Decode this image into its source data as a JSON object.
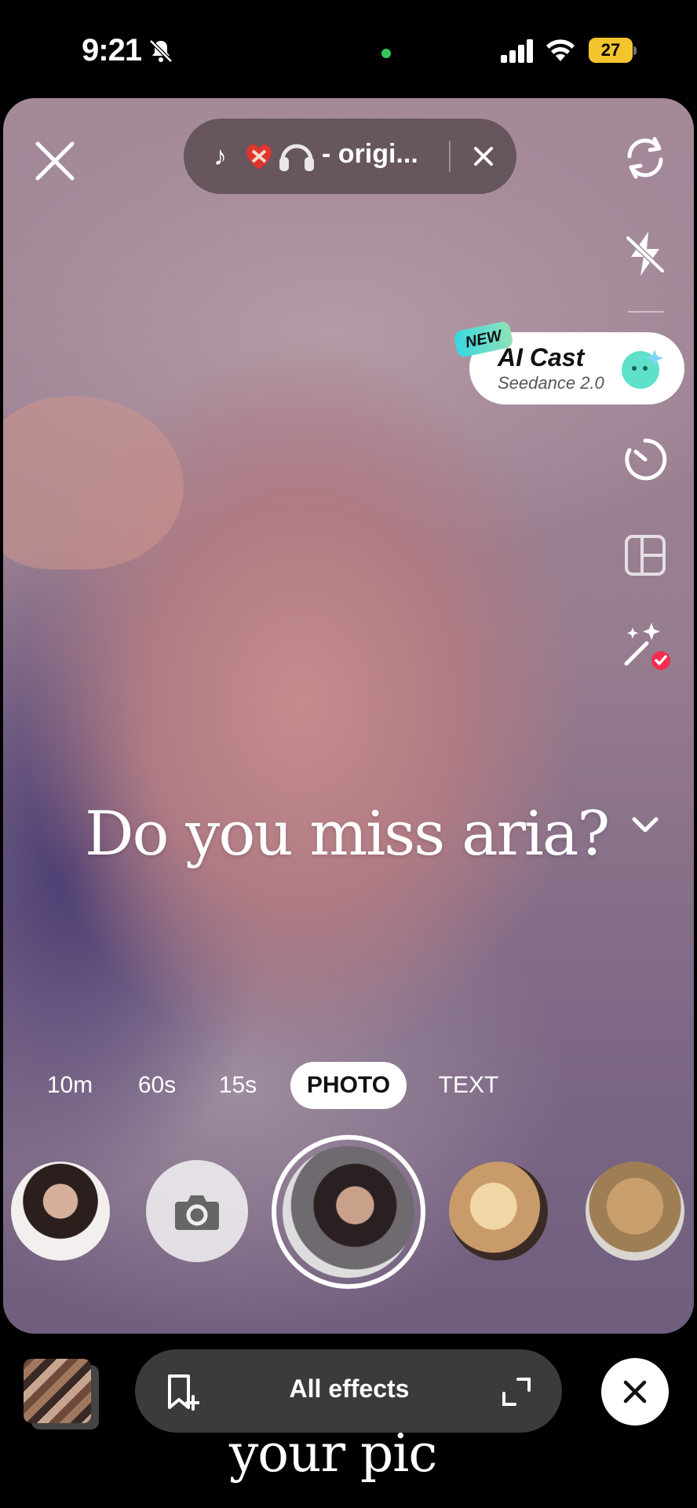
{
  "status_bar": {
    "time": "9:21",
    "battery_level": "27",
    "icons": [
      "bell-slash-icon",
      "camera-indicator-dot",
      "cellular-signal-icon",
      "wifi-icon",
      "battery-charging-icon"
    ],
    "camera_indicator_color": "#34c759",
    "battery_color": "#f3c52d"
  },
  "top_bar": {
    "close_icon": "close-icon",
    "sound": {
      "note_glyph": "♪",
      "emoji_glyphs": [
        "❤️‍🩹",
        "🎧"
      ],
      "title": "- origi...",
      "remove_icon": "close-icon"
    }
  },
  "side_tools": {
    "items": [
      "flip-camera-icon",
      "flash-off-icon",
      "timer-icon",
      "layout-icon",
      "enhance-icon"
    ],
    "ai_cast": {
      "badge": "NEW",
      "title": "AI Cast",
      "subtitle": "Seedance 2.0",
      "icon": "ai-cast-icon"
    },
    "more_icon": "chevron-down-icon"
  },
  "overlay": {
    "caption": "Do you miss aria?"
  },
  "modes": {
    "tabs": [
      "10m",
      "60s",
      "15s",
      "PHOTO",
      "TEXT"
    ],
    "selected": "PHOTO"
  },
  "carousel": {
    "items": [
      "effect-thumb-1",
      "photo-mode-button",
      "capture-button",
      "effect-thumb-3",
      "effect-thumb-4"
    ]
  },
  "bottom_bar": {
    "effects_label": "All effects",
    "icons": [
      "gallery-thumbnail",
      "bookmark-add-icon",
      "expand-icon",
      "close-icon"
    ]
  },
  "bottom_caption": "your pic"
}
